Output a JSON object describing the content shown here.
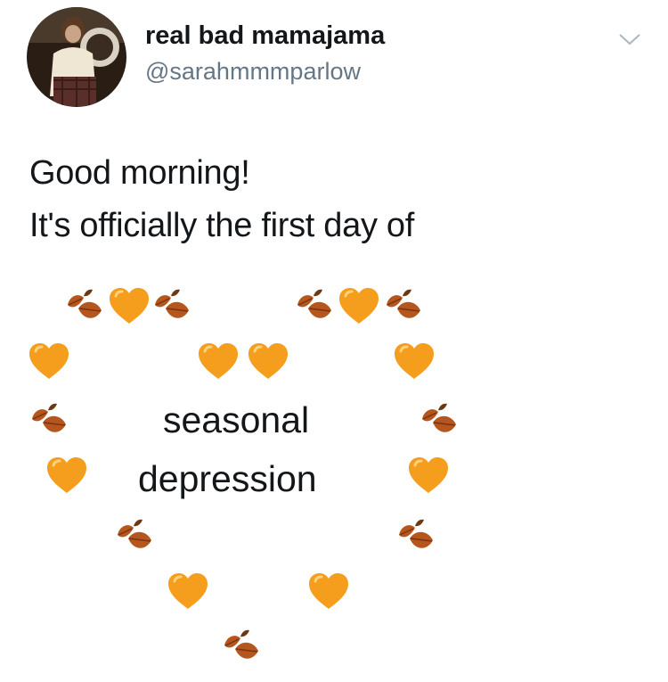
{
  "tweet": {
    "author": {
      "display_name": "real bad mamajama",
      "handle": "@sarahmmmparlow",
      "avatar_icon": "profile-photo"
    },
    "menu_icon": "chevron-down-icon",
    "lines": [
      "Good morning!",
      "It's officially the first day of"
    ],
    "art": {
      "words": [
        "seasonal",
        "depression"
      ],
      "emoji_sequence": [
        "fallen-leaf",
        "orange-heart",
        "fallen-leaf",
        "fallen-leaf",
        "orange-heart",
        "fallen-leaf",
        "orange-heart",
        "orange-heart",
        "orange-heart",
        "orange-heart",
        "fallen-leaf",
        "fallen-leaf",
        "orange-heart",
        "orange-heart",
        "fallen-leaf",
        "fallen-leaf",
        "orange-heart",
        "orange-heart",
        "fallen-leaf"
      ]
    }
  },
  "colors": {
    "text": "#14171a",
    "handle": "#657786",
    "heart": "#f59d1c",
    "leaf": "#b5561e"
  }
}
